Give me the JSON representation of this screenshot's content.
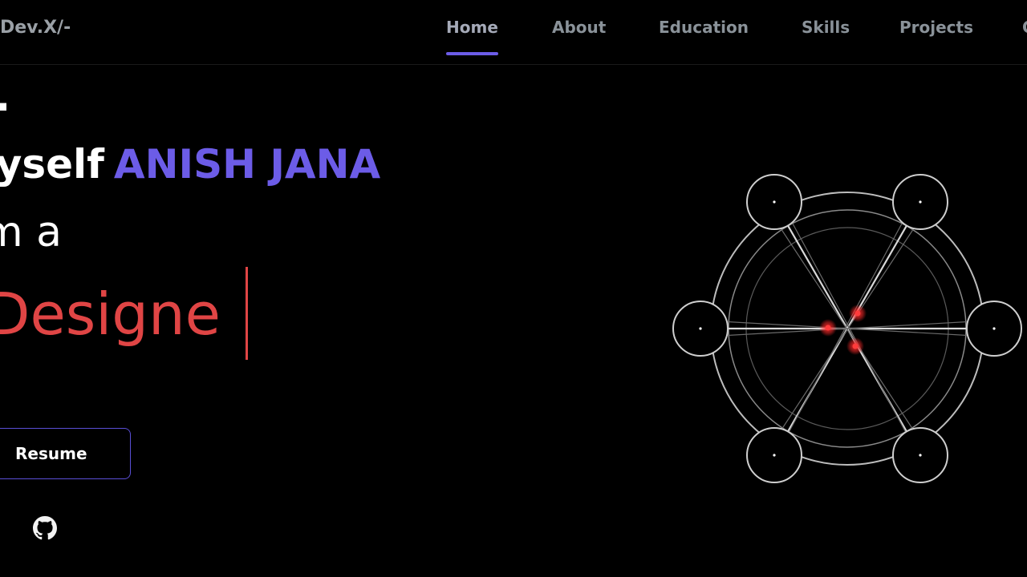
{
  "header": {
    "logo": "Dev.X/-",
    "nav": [
      {
        "label": "Home",
        "active": true
      },
      {
        "label": "About",
        "active": false
      },
      {
        "label": "Education",
        "active": false
      },
      {
        "label": "Skills",
        "active": false
      },
      {
        "label": "Projects",
        "active": false
      },
      {
        "label": "C",
        "active": false
      }
    ]
  },
  "hero": {
    "greeting": "i..",
    "intro_prefix": "Myself",
    "name": "ANISH JANA",
    "role_prefix": "m a",
    "typed_text": "Designe",
    "resume_label": "Resume"
  },
  "icons": {
    "github": "github-icon",
    "graphic": "hexagram-orbit-graphic"
  },
  "colors": {
    "background": "#000000",
    "accent": "#6c5ce7",
    "typed": "#e04545",
    "text": "#ffffff",
    "nav_text": "#8a9299"
  }
}
